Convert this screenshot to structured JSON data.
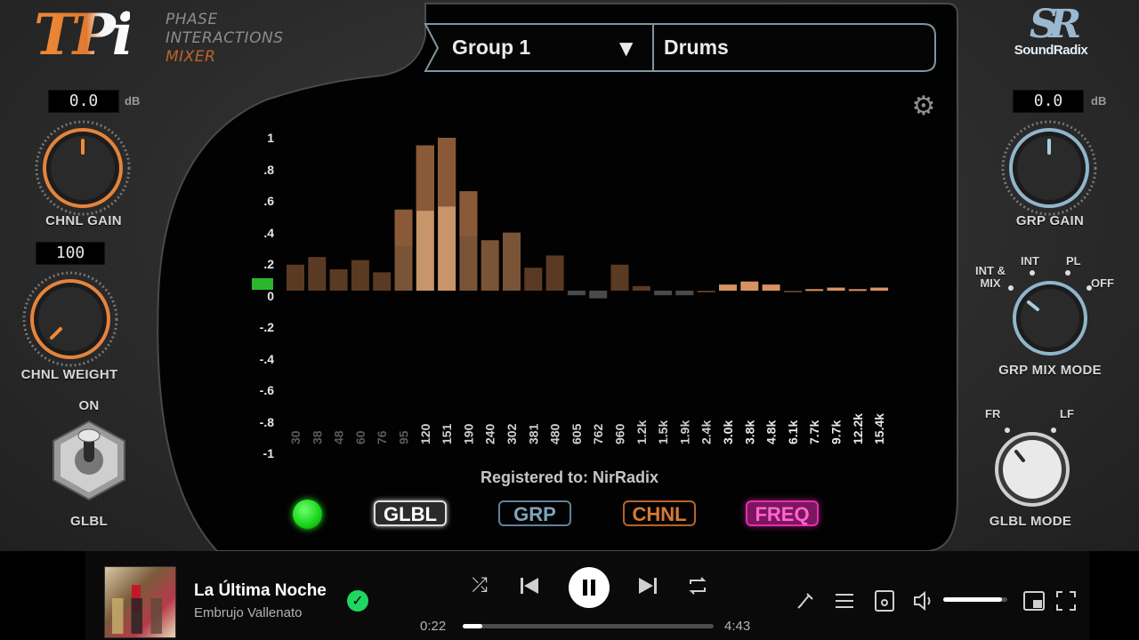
{
  "logo": {
    "mark": "TPi",
    "line1": "PHASE",
    "line2": "INTERACTIONS",
    "line3": "MIXER"
  },
  "brand": {
    "mark": "SR",
    "name": "SoundRadix"
  },
  "left": {
    "chnl_gain_value": "0.0",
    "chnl_gain_unit": "dB",
    "chnl_gain_label": "CHNL GAIN",
    "chnl_weight_value": "100",
    "chnl_weight_label": "CHNL WEIGHT",
    "toggle_on_label": "ON",
    "toggle_label": "GLBL"
  },
  "right": {
    "grp_gain_value": "0.0",
    "grp_gain_unit": "dB",
    "grp_gain_label": "GRP GAIN",
    "mix_mode_label": "GRP MIX MODE",
    "mix_mode_options": [
      "INT & MIX",
      "INT",
      "PL",
      "OFF"
    ],
    "glbl_mode_label": "GLBL MODE",
    "glbl_mode_options": [
      "FR",
      "LF"
    ]
  },
  "header": {
    "group": "Group 1",
    "group_arrow": "▼",
    "track": "Drums"
  },
  "chart_data": {
    "type": "bar",
    "categories": [
      "30",
      "38",
      "48",
      "60",
      "76",
      "95",
      "120",
      "151",
      "190",
      "240",
      "302",
      "381",
      "480",
      "605",
      "762",
      "960",
      "1.2k",
      "1.5k",
      "1.9k",
      "2.4k",
      "3.0k",
      "3.8k",
      "4.8k",
      "6.1k",
      "7.7k",
      "9.7k",
      "12.2k",
      "15.4k"
    ],
    "values": [
      0.17,
      0.22,
      0.14,
      0.2,
      0.12,
      0.53,
      0.95,
      1.0,
      0.65,
      0.33,
      0.38,
      0.15,
      0.23,
      -0.03,
      -0.05,
      0.17,
      0.03,
      -0.03,
      -0.03,
      0.0,
      0.04,
      0.06,
      0.04,
      0.0,
      0.01,
      0.02,
      0.01,
      0.02
    ],
    "yticks": [
      "1",
      ".8",
      ".6",
      ".4",
      ".2",
      "0",
      "-.2",
      "-.4",
      "-.6",
      "-.8",
      "-1"
    ],
    "ylim": [
      -1,
      1
    ],
    "colors": {
      "low": "#5a3a22",
      "mid": "#7a5436",
      "high": "#c8956a",
      "neg": "#4a4a4a"
    }
  },
  "registered": "Registered to: NirRadix",
  "modes": {
    "glbl": "GLBL",
    "grp": "GRP",
    "chnl": "CHNL",
    "freq": "FREQ"
  },
  "player": {
    "song": "La Última Noche",
    "artist": "Embrujo Vallenato",
    "elapsed": "0:22",
    "total": "4:43",
    "progress": 0.078,
    "volume": 0.92
  }
}
